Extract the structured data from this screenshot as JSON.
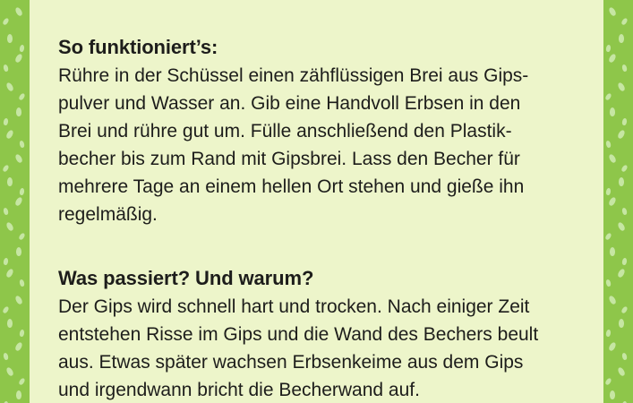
{
  "content": {
    "section1": {
      "title": "So funktioniert’s:",
      "lines": [
        "Rühre in der Schüssel einen zähflüssigen Brei aus Gips-",
        "pulver und Wasser an. Gib eine Handvoll Erbsen in den",
        "Brei und rühre gut um. Fülle anschließend den Plastik-",
        "becher bis zum Rand mit Gipsbrei. Lass den Becher für",
        "mehrere Tage an einem hellen Ort stehen und gieße ihn",
        "regelmäßig."
      ]
    },
    "section2": {
      "title": "Was passiert? Und warum?",
      "lines": [
        "Der Gips wird schnell hart und trocken. Nach einiger Zeit",
        "entstehen Risse im Gips und die Wand des Bechers beult",
        "aus. Etwas später wachsen Erbsenkeime aus dem Gips",
        "und irgendwann bricht die Becherwand auf."
      ]
    }
  },
  "colors": {
    "background_green": "#8ec64a",
    "pattern_light_green": "#c9e8a8",
    "panel_cream": "#edf5ca",
    "text_dark": "#1d1d1b"
  }
}
